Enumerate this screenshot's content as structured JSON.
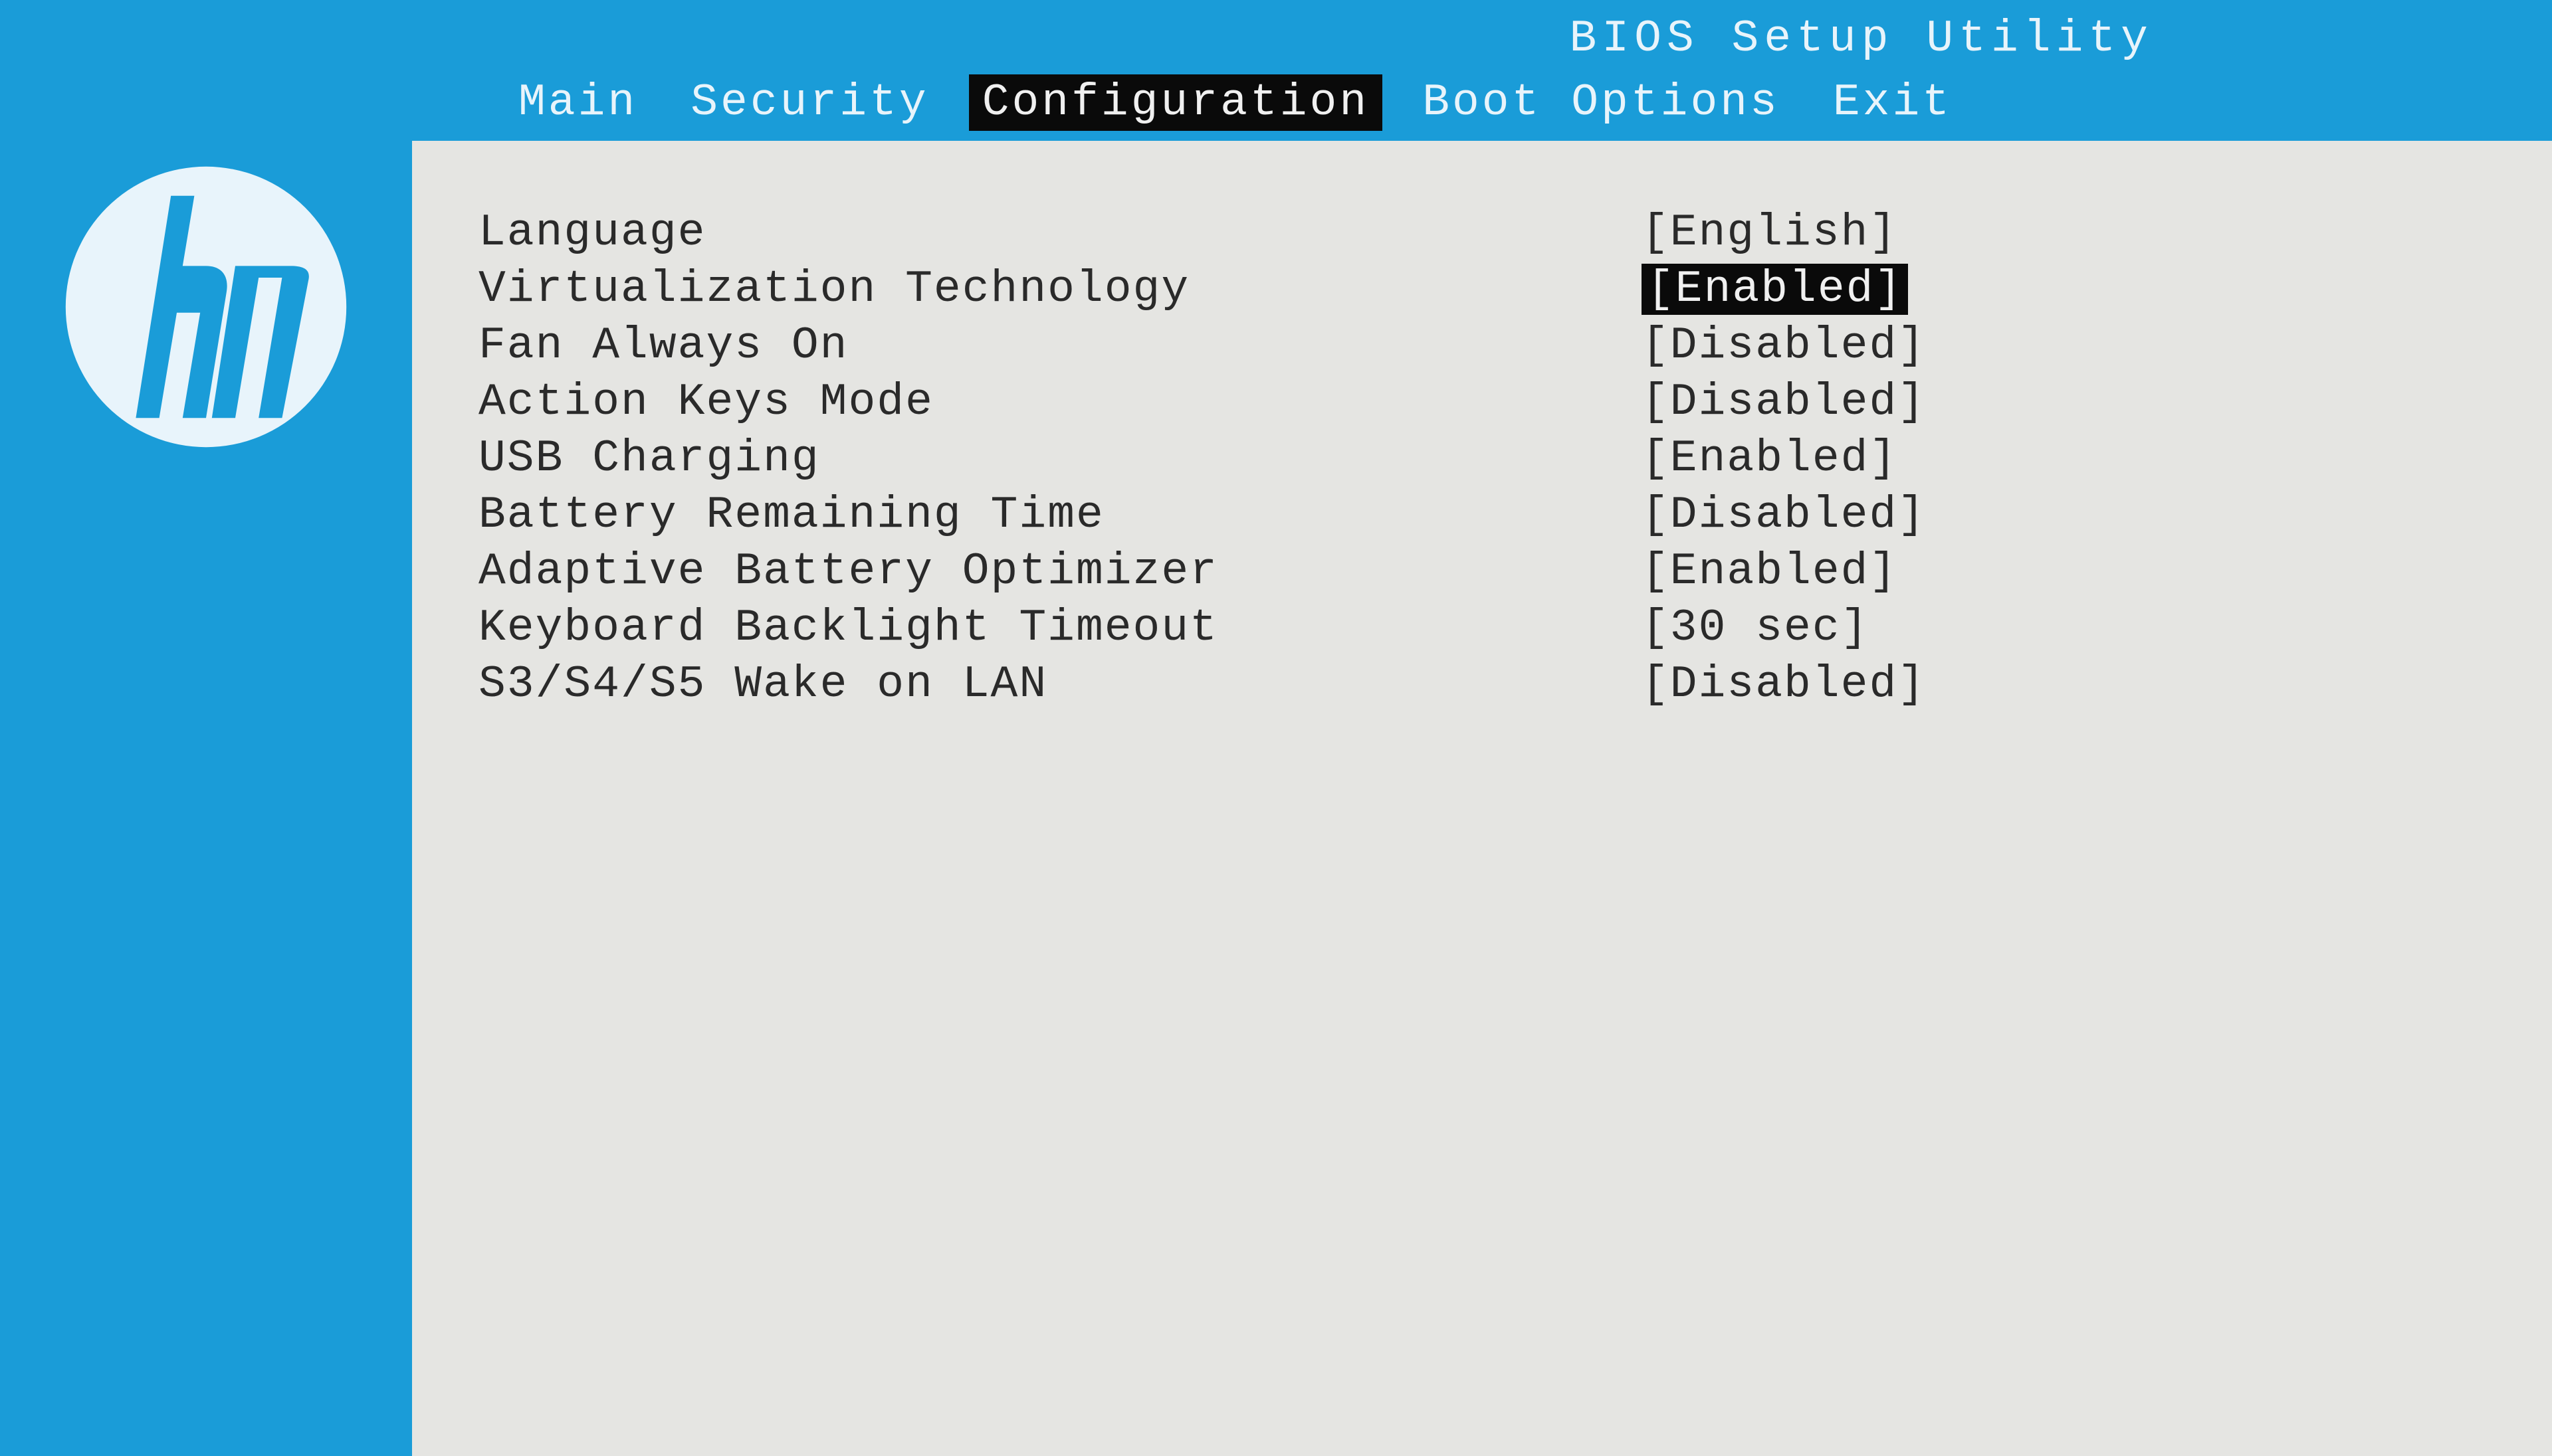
{
  "header": {
    "title": "BIOS Setup Utility"
  },
  "tabs": [
    {
      "label": "Main"
    },
    {
      "label": "Security"
    },
    {
      "label": "Configuration"
    },
    {
      "label": "Boot Options"
    },
    {
      "label": "Exit"
    }
  ],
  "active_tab_index": 2,
  "settings": [
    {
      "label": "Language",
      "value": "[English]",
      "selected": false
    },
    {
      "label": "Virtualization Technology",
      "value": "[Enabled]",
      "selected": true
    },
    {
      "label": "Fan Always On",
      "value": "[Disabled]",
      "selected": false
    },
    {
      "label": "Action Keys Mode",
      "value": "[Disabled]",
      "selected": false
    },
    {
      "label": "USB Charging",
      "value": "[Enabled]",
      "selected": false
    },
    {
      "label": "Battery Remaining Time",
      "value": "[Disabled]",
      "selected": false
    },
    {
      "label": "Adaptive Battery Optimizer",
      "value": "[Enabled]",
      "selected": false
    },
    {
      "label": "Keyboard Backlight Timeout",
      "value": "[30 sec]",
      "selected": false
    },
    {
      "label": "S3/S4/S5 Wake on LAN",
      "value": "[Disabled]",
      "selected": false
    }
  ],
  "logo_name": "hp"
}
